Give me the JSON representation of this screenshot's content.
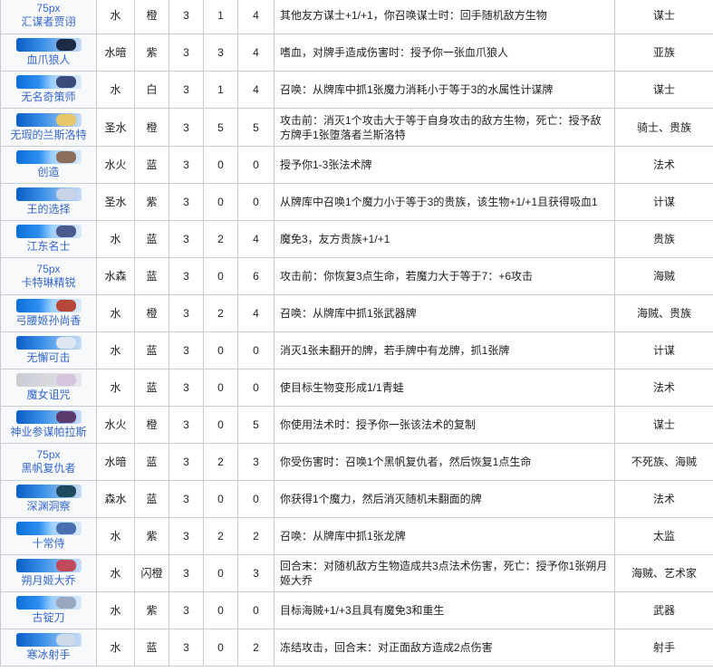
{
  "rows": [
    {
      "placeholder": "75px",
      "thumb": false,
      "name": "汇谋者贾诩",
      "attr": "水",
      "rarity": "橙",
      "cost": "3",
      "atk": "1",
      "hp": "4",
      "desc": "其他友方谋士+1/+1，你召唤谋士时：回手随机敌方生物",
      "tag": "谋士",
      "art_color": ""
    },
    {
      "placeholder": "",
      "thumb": true,
      "name": "血爪狼人",
      "attr": "水暗",
      "rarity": "紫",
      "cost": "3",
      "atk": "3",
      "hp": "4",
      "desc": "嗜血，对牌手造成伤害时：授予你一张血爪狼人",
      "tag": "亚族",
      "art_color": "#1c2a44"
    },
    {
      "placeholder": "",
      "thumb": true,
      "name": "无名奇策师",
      "attr": "水",
      "rarity": "白",
      "cost": "3",
      "atk": "1",
      "hp": "4",
      "desc": "召唤：从牌库中抓1张魔力消耗小于等于3的水属性计谋牌",
      "tag": "谋士",
      "art_color": "#3b4a7a"
    },
    {
      "placeholder": "",
      "thumb": true,
      "name": "无瑕的兰斯洛特",
      "attr": "圣水",
      "rarity": "橙",
      "cost": "3",
      "atk": "5",
      "hp": "5",
      "desc": "攻击前：消灭1个攻击大于等于自身攻击的敌方生物，死亡：授予敌方牌手1张堕落者兰斯洛特",
      "tag": "骑士、贵族",
      "art_color": "#e8c66a"
    },
    {
      "placeholder": "",
      "thumb": true,
      "name": "创造",
      "attr": "水火",
      "rarity": "蓝",
      "cost": "3",
      "atk": "0",
      "hp": "0",
      "desc": "授予你1-3张法术牌",
      "tag": "法术",
      "art_color": "#8a6d5a"
    },
    {
      "placeholder": "",
      "thumb": true,
      "name": "王的选择",
      "attr": "圣水",
      "rarity": "紫",
      "cost": "3",
      "atk": "0",
      "hp": "0",
      "desc": "从牌库中召唤1个魔力小于等于3的贵族，该生物+1/+1且获得吸血1",
      "tag": "计谋",
      "art_color": "#c9d3e6"
    },
    {
      "placeholder": "",
      "thumb": true,
      "name": "江东名士",
      "attr": "水",
      "rarity": "蓝",
      "cost": "3",
      "atk": "2",
      "hp": "4",
      "desc": "魔免3，友方贵族+1/+1",
      "tag": "贵族",
      "art_color": "#4a5a8e"
    },
    {
      "placeholder": "75px",
      "thumb": false,
      "name": "卡特琳精锐",
      "attr": "水森",
      "rarity": "蓝",
      "cost": "3",
      "atk": "0",
      "hp": "6",
      "desc": "攻击前：你恢复3点生命，若魔力大于等于7：+6攻击",
      "tag": "海贼",
      "art_color": ""
    },
    {
      "placeholder": "",
      "thumb": true,
      "name": "弓腰姬孙尚香",
      "attr": "水",
      "rarity": "橙",
      "cost": "3",
      "atk": "2",
      "hp": "4",
      "desc": "召唤：从牌库中抓1张武器牌",
      "tag": "海贼、贵族",
      "art_color": "#b8473a"
    },
    {
      "placeholder": "",
      "thumb": true,
      "name": "无懈可击",
      "attr": "水",
      "rarity": "蓝",
      "cost": "3",
      "atk": "0",
      "hp": "0",
      "desc": "消灭1张未翻开的牌，若手牌中有龙牌，抓1张牌",
      "tag": "计谋",
      "art_color": "#dfe6f4"
    },
    {
      "placeholder": "",
      "thumb": true,
      "name": "魔女诅咒",
      "attr": "水",
      "rarity": "蓝",
      "cost": "3",
      "atk": "0",
      "hp": "0",
      "desc": "使目标生物变形成1/1青蛙",
      "tag": "法术",
      "art_color": "#d6c4dd",
      "plain": true
    },
    {
      "placeholder": "",
      "thumb": true,
      "name": "神业参谋帕拉斯",
      "attr": "水火",
      "rarity": "橙",
      "cost": "3",
      "atk": "0",
      "hp": "5",
      "desc": "你使用法术时：授予你一张该法术的复制",
      "tag": "谋士",
      "art_color": "#5b3a6e"
    },
    {
      "placeholder": "75px",
      "thumb": false,
      "name": "黑帆复仇者",
      "attr": "水暗",
      "rarity": "蓝",
      "cost": "3",
      "atk": "2",
      "hp": "3",
      "desc": "你受伤害时：召唤1个黑帆复仇者，然后恢复1点生命",
      "tag": "不死族、海贼",
      "art_color": ""
    },
    {
      "placeholder": "",
      "thumb": true,
      "name": "深渊洞察",
      "attr": "森水",
      "rarity": "蓝",
      "cost": "3",
      "atk": "0",
      "hp": "0",
      "desc": "你获得1个魔力，然后消灭随机未翻面的牌",
      "tag": "法术",
      "art_color": "#1f4a5e"
    },
    {
      "placeholder": "",
      "thumb": true,
      "name": "十常侍",
      "attr": "水",
      "rarity": "紫",
      "cost": "3",
      "atk": "2",
      "hp": "2",
      "desc": "召唤：从牌库中抓1张龙牌",
      "tag": "太监",
      "art_color": "#4a6fb0"
    },
    {
      "placeholder": "",
      "thumb": true,
      "name": "朔月姬大乔",
      "attr": "水",
      "rarity": "闪橙",
      "cost": "3",
      "atk": "0",
      "hp": "3",
      "desc": "回合末：对随机敌方生物造成共3点法术伤害，死亡：授予你1张朔月姬大乔",
      "tag": "海贼、艺术家",
      "art_color": "#c04a5a"
    },
    {
      "placeholder": "",
      "thumb": true,
      "name": "古锭刀",
      "attr": "水",
      "rarity": "紫",
      "cost": "3",
      "atk": "0",
      "hp": "0",
      "desc": "目标海贼+1/+3且具有魔免3和重生",
      "tag": "武器",
      "art_color": "#9aa7c0"
    },
    {
      "placeholder": "",
      "thumb": true,
      "name": "寒冰射手",
      "attr": "水",
      "rarity": "蓝",
      "cost": "3",
      "atk": "0",
      "hp": "2",
      "desc": "冻结攻击，回合末：对正面敌方造成2点伤害",
      "tag": "射手",
      "art_color": "#cfd8e8"
    }
  ]
}
